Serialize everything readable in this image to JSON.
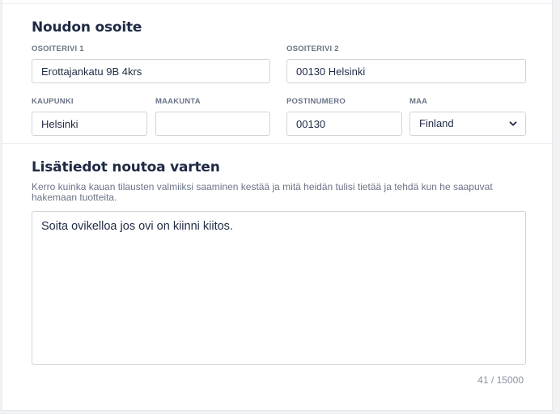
{
  "address_section": {
    "title": "Noudon osoite",
    "address_line1": {
      "label": "OSOITERIVI 1",
      "value": "Erottajankatu 9B 4krs"
    },
    "address_line2": {
      "label": "OSOITERIVI 2",
      "value": "00130 Helsinki"
    },
    "city": {
      "label": "KAUPUNKI",
      "value": "Helsinki"
    },
    "province": {
      "label": "MAAKUNTA",
      "value": ""
    },
    "postal_code": {
      "label": "POSTINUMERO",
      "value": "00130"
    },
    "country": {
      "label": "MAA",
      "value": "Finland"
    }
  },
  "pickup_info": {
    "title": "Lisätiedot noutoa varten",
    "help_text": "Kerro kuinka kauan tilausten valmiiksi saaminen kestää ja mitä heidän tulisi tietää ja tehdä kun he saapuvat hakemaan tuotteita.",
    "value": "Soita ovikelloa jos ovi on kiinni kiitos.",
    "counter": "41 / 15000"
  }
}
